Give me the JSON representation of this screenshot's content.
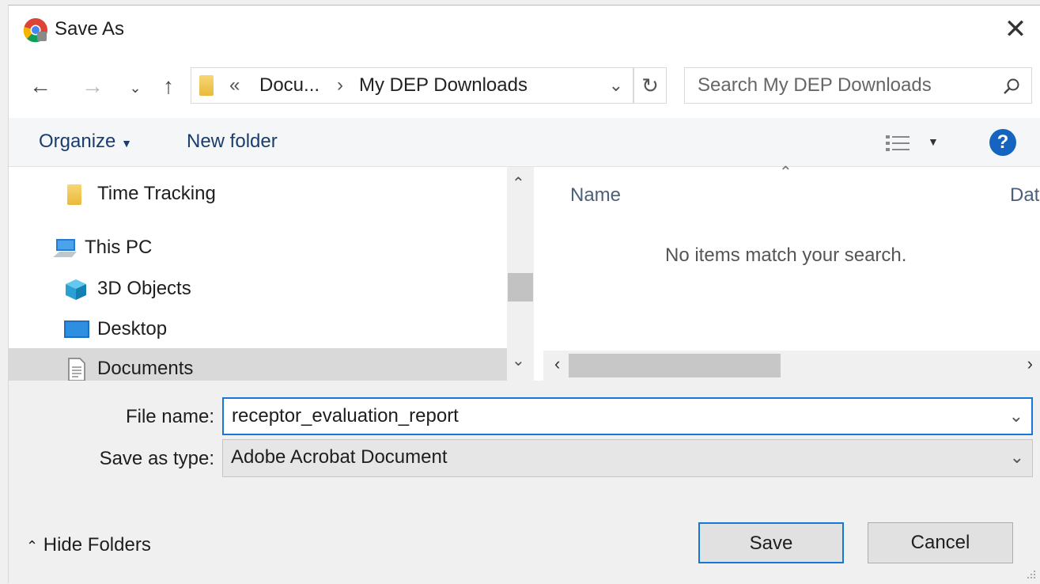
{
  "window": {
    "title": "Save As"
  },
  "nav": {
    "address": {
      "overflow": "«",
      "crumb1": "Docu...",
      "separator": "›",
      "crumb2": "My DEP Downloads"
    },
    "search_placeholder": "Search My DEP Downloads"
  },
  "toolbar": {
    "organize_label": "Organize",
    "new_folder_label": "New folder",
    "help_label": "?"
  },
  "tree": {
    "items": [
      {
        "label": "Time Tracking",
        "icon": "folder-icon"
      },
      {
        "label": "This PC",
        "icon": "computer-icon"
      },
      {
        "label": "3D Objects",
        "icon": "cube-icon"
      },
      {
        "label": "Desktop",
        "icon": "desktop-icon"
      },
      {
        "label": "Documents",
        "icon": "document-icon",
        "selected": true
      }
    ]
  },
  "content": {
    "columns": [
      "Name",
      "Dat"
    ],
    "empty_message": "No items match your search."
  },
  "form": {
    "file_name_label": "File name:",
    "file_name_value": "receptor_evaluation_report",
    "save_type_label": "Save as type:",
    "save_type_value": "Adobe Acrobat Document"
  },
  "footer": {
    "hide_folders_label": "Hide Folders",
    "save_label": "Save",
    "cancel_label": "Cancel"
  },
  "colors": {
    "accent": "#1778d4",
    "help": "#1565c0"
  }
}
